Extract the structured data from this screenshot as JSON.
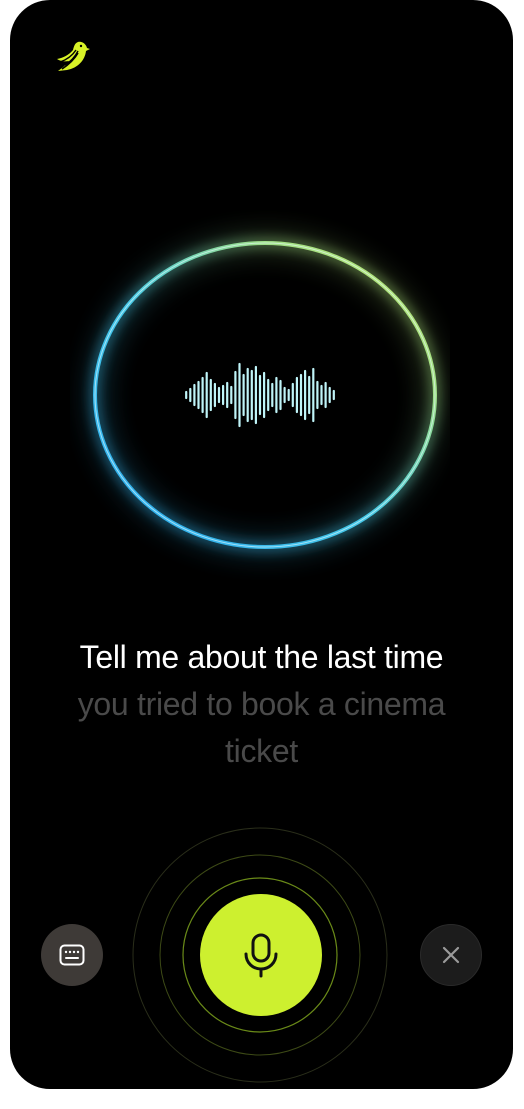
{
  "app": {
    "logo_icon": "bird-logo-icon",
    "accent_color": "#cdf02f"
  },
  "visualizer": {
    "icon": "audio-waveform-icon",
    "ring_colors": [
      "#3fb4f2",
      "#b6e36a"
    ]
  },
  "prompt": {
    "line1": "Tell me about the last time",
    "line2": "you tried to book a cinema",
    "line3": "ticket"
  },
  "controls": {
    "keyboard_icon": "keyboard-icon",
    "mic_icon": "microphone-icon",
    "close_icon": "close-icon"
  }
}
